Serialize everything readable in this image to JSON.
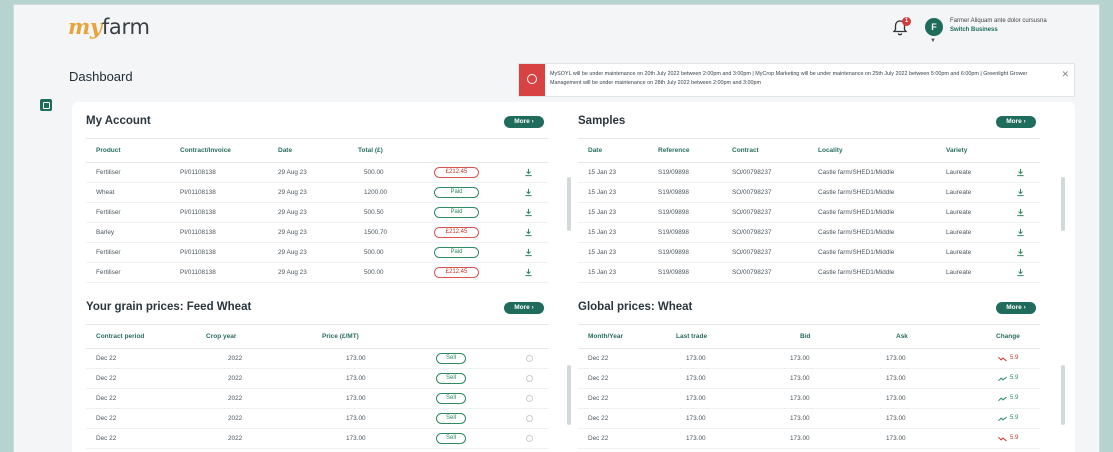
{
  "app": {
    "logo_my": "my",
    "logo_farm": "farm"
  },
  "user": {
    "name": "Farmer Aliquam ante dolor cursusna",
    "switch_label": "Switch Business",
    "initial": "F",
    "notifications": "1"
  },
  "page": {
    "title": "Dashboard"
  },
  "notice": {
    "text": "MySOYL will be under maintenance on 20th July 2022 between 2:00pm and 3:00pm | MyCrop Marketing will be under maintenance on 25th July 2022 between 5:00pm and 6:00pm | Greenlight Grower Management will be under maintenance on 28th July 2022 between 2:00pm and 3:00pm"
  },
  "more_label": "More",
  "account": {
    "title": "My Account",
    "columns": [
      "Product",
      "Contract/Invoice",
      "Date",
      "Total (£)"
    ],
    "rows": [
      {
        "product": "Fertiliser",
        "ref": "PI/01108138",
        "date": "29 Aug 23",
        "total": "500.00",
        "status": "£212.45",
        "status_type": "due"
      },
      {
        "product": "Wheat",
        "ref": "PI/01108138",
        "date": "29 Aug 23",
        "total": "1200.00",
        "status": "Paid",
        "status_type": "paid"
      },
      {
        "product": "Fertiliser",
        "ref": "PI/01108138",
        "date": "29 Aug 23",
        "total": "500.50",
        "status": "Paid",
        "status_type": "paid"
      },
      {
        "product": "Barley",
        "ref": "PI/01108138",
        "date": "29 Aug 23",
        "total": "1500.70",
        "status": "£212.45",
        "status_type": "due"
      },
      {
        "product": "Fertiliser",
        "ref": "PI/01108138",
        "date": "29 Aug 23",
        "total": "500.00",
        "status": "Paid",
        "status_type": "paid"
      },
      {
        "product": "Fertiliser",
        "ref": "PI/01108138",
        "date": "29 Aug 23",
        "total": "500.00",
        "status": "£212.45",
        "status_type": "due"
      }
    ]
  },
  "samples": {
    "title": "Samples",
    "columns": [
      "Date",
      "Reference",
      "Contract",
      "Locality",
      "Variety"
    ],
    "rows": [
      {
        "date": "15 Jan 23",
        "ref": "S19/09898",
        "contract": "SO/00798237",
        "locality": "Castle farm/SHED1/Middle",
        "variety": "Laureate"
      },
      {
        "date": "15 Jan 23",
        "ref": "S19/09898",
        "contract": "SO/00798237",
        "locality": "Castle farm/SHED1/Middle",
        "variety": "Laureate"
      },
      {
        "date": "15 Jan 23",
        "ref": "S19/09898",
        "contract": "SO/00798237",
        "locality": "Castle farm/SHED1/Middle",
        "variety": "Laureate"
      },
      {
        "date": "15 Jan 23",
        "ref": "S19/09898",
        "contract": "SO/00798237",
        "locality": "Castle farm/SHED1/Middle",
        "variety": "Laureate"
      },
      {
        "date": "15 Jan 23",
        "ref": "S19/09898",
        "contract": "SO/00798237",
        "locality": "Castle farm/SHED1/Middle",
        "variety": "Laureate"
      },
      {
        "date": "15 Jan 23",
        "ref": "S19/09898",
        "contract": "SO/00798237",
        "locality": "Castle farm/SHED1/Middle",
        "variety": "Laureate"
      }
    ]
  },
  "grain": {
    "title": "Your grain prices: Feed Wheat",
    "columns": [
      "Contract period",
      "Crop year",
      "Price (£/MT)"
    ],
    "sell_label": "Sell",
    "rows": [
      {
        "period": "Dec 22",
        "year": "2022",
        "price": "173.00"
      },
      {
        "period": "Dec 22",
        "year": "2022",
        "price": "173.00"
      },
      {
        "period": "Dec 22",
        "year": "2022",
        "price": "173.00"
      },
      {
        "period": "Dec 22",
        "year": "2022",
        "price": "173.00"
      },
      {
        "period": "Dec 22",
        "year": "2022",
        "price": "173.00"
      }
    ]
  },
  "global": {
    "title": "Global prices: Wheat",
    "columns": [
      "Month/Year",
      "Last trade",
      "Bid",
      "Ask",
      "Change"
    ],
    "rows": [
      {
        "month": "Dec 22",
        "last": "173.00",
        "bid": "173.00",
        "ask": "173.00",
        "change": "5.9",
        "dir": "down"
      },
      {
        "month": "Dec 22",
        "last": "173.00",
        "bid": "173.00",
        "ask": "173.00",
        "change": "5.9",
        "dir": "up"
      },
      {
        "month": "Dec 22",
        "last": "173.00",
        "bid": "173.00",
        "ask": "173.00",
        "change": "5.9",
        "dir": "up"
      },
      {
        "month": "Dec 22",
        "last": "173.00",
        "bid": "173.00",
        "ask": "173.00",
        "change": "5.9",
        "dir": "up"
      },
      {
        "month": "Dec 22",
        "last": "173.00",
        "bid": "173.00",
        "ask": "173.00",
        "change": "5.9",
        "dir": "down"
      }
    ]
  },
  "colors": {
    "brand": "#1f6b5c",
    "accent": "#e8a33b",
    "danger": "#d94242",
    "success": "#2f8a62"
  },
  "icons": {
    "bell": "bell-icon",
    "download": "download-icon",
    "alert": "alert-icon",
    "close": "close-icon",
    "trend_up": "trend-up-icon",
    "trend_down": "trend-down-icon"
  }
}
